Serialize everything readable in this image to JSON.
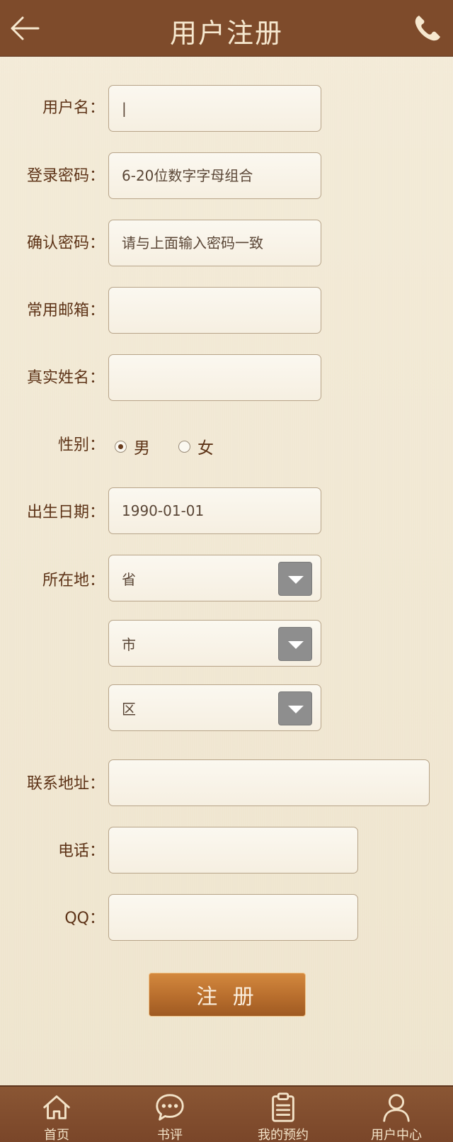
{
  "header": {
    "title": "用户注册",
    "back_icon": "arrow-left-icon",
    "phone_icon": "phone-icon"
  },
  "form": {
    "username": {
      "label": "用户名：",
      "value": "|"
    },
    "password": {
      "label": "登录密码：",
      "placeholder": "6-20位数字字母组合"
    },
    "confirm_password": {
      "label": "确认密码：",
      "placeholder": "请与上面输入密码一致"
    },
    "email": {
      "label": "常用邮箱：",
      "value": ""
    },
    "real_name": {
      "label": "真实姓名：",
      "value": ""
    },
    "gender": {
      "label": "性别：",
      "options": [
        "男",
        "女"
      ],
      "selected": "男"
    },
    "birthday": {
      "label": "出生日期：",
      "value": "1990-01-01"
    },
    "location": {
      "label": "所在地：",
      "province": "省",
      "city": "市",
      "district": "区"
    },
    "address": {
      "label": "联系地址：",
      "value": ""
    },
    "phone": {
      "label": "电话：",
      "value": ""
    },
    "qq": {
      "label": "QQ：",
      "value": ""
    },
    "submit_label": "注 册"
  },
  "bottom_nav": [
    {
      "label": "首页",
      "icon": "home-icon"
    },
    {
      "label": "书评",
      "icon": "chat-bubble-icon"
    },
    {
      "label": "我的预约",
      "icon": "clipboard-icon"
    },
    {
      "label": "用户中心",
      "icon": "user-icon"
    }
  ],
  "colors": {
    "header_bg": "#7e4b2b",
    "page_bg": "#f0e7d2",
    "label_text": "#5d3317",
    "button_bg": "#b86e2d"
  }
}
